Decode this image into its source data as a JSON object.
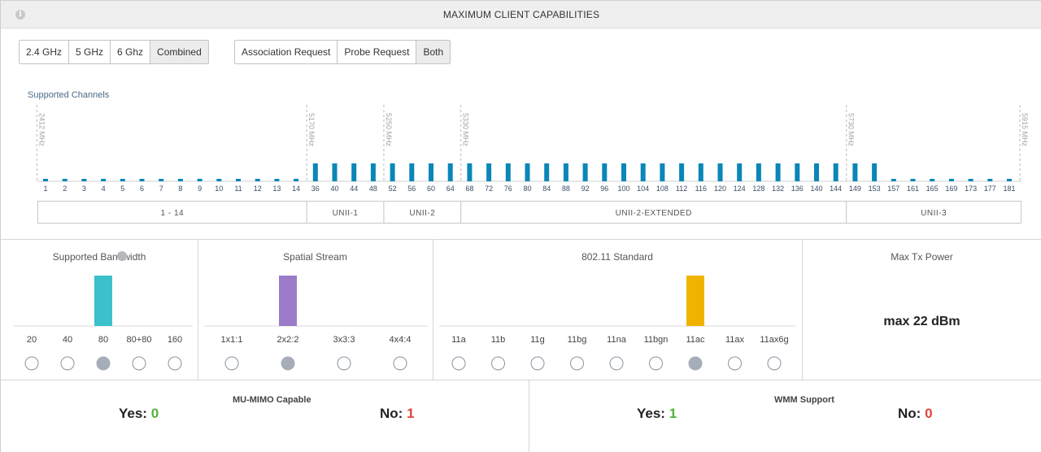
{
  "header": {
    "title": "MAXIMUM CLIENT CAPABILITIES"
  },
  "bands_filter": [
    "2.4 GHz",
    "5 GHz",
    "6 Ghz",
    "Combined"
  ],
  "bands_filter_active": "Combined",
  "request_filter": [
    "Association Request",
    "Probe Request",
    "Both"
  ],
  "request_filter_active": "Both",
  "channels": {
    "title": "Supported Channels",
    "bar_color": "#0a86b8",
    "labels": [
      "1",
      "2",
      "3",
      "4",
      "5",
      "6",
      "7",
      "8",
      "9",
      "10",
      "11",
      "12",
      "13",
      "14",
      "36",
      "40",
      "44",
      "48",
      "52",
      "56",
      "60",
      "64",
      "68",
      "72",
      "76",
      "80",
      "84",
      "88",
      "92",
      "96",
      "100",
      "104",
      "108",
      "112",
      "116",
      "120",
      "124",
      "128",
      "132",
      "136",
      "140",
      "144",
      "149",
      "153",
      "157",
      "161",
      "165",
      "169",
      "173",
      "177",
      "181"
    ],
    "supported": [
      0,
      0,
      0,
      0,
      0,
      0,
      0,
      0,
      0,
      0,
      0,
      0,
      0,
      0,
      1,
      1,
      1,
      1,
      1,
      1,
      1,
      1,
      1,
      1,
      1,
      1,
      1,
      1,
      1,
      1,
      1,
      1,
      1,
      1,
      1,
      1,
      1,
      1,
      1,
      1,
      1,
      1,
      1,
      1,
      0,
      0,
      0,
      0,
      0,
      0,
      0
    ],
    "freq_markers": [
      {
        "label": "2412 MHz",
        "before_index": 0
      },
      {
        "label": "5170 MHz",
        "before_index": 14
      },
      {
        "label": "5250 MHz",
        "before_index": 18
      },
      {
        "label": "5330 MHz",
        "before_index": 22
      },
      {
        "label": "5730 MHz",
        "before_index": 42
      },
      {
        "label": "5915 MHz",
        "before_index": 51
      }
    ],
    "bands": [
      {
        "label": "1 - 14",
        "from": 0,
        "to": 13
      },
      {
        "label": "UNII-1",
        "from": 14,
        "to": 17
      },
      {
        "label": "UNII-2",
        "from": 18,
        "to": 21
      },
      {
        "label": "UNII-2-EXTENDED",
        "from": 22,
        "to": 41
      },
      {
        "label": "UNII-3",
        "from": 42,
        "to": 50
      }
    ]
  },
  "bandwidth": {
    "title": "Supported Bandwidth",
    "color": "#3cc0cc",
    "labels": [
      "20",
      "40",
      "80",
      "80+80",
      "160"
    ],
    "selected": 2
  },
  "spatial": {
    "title": "Spatial Stream",
    "color": "#9b7cc8",
    "labels": [
      "1x1:1",
      "2x2:2",
      "3x3:3",
      "4x4:4"
    ],
    "selected": 1
  },
  "standard": {
    "title": "802.11 Standard",
    "color": "#f0b400",
    "labels": [
      "11a",
      "11b",
      "11g",
      "11bg",
      "11na",
      "11bgn",
      "11ac",
      "11ax",
      "11ax6g"
    ],
    "selected": 6
  },
  "tx_power": {
    "title": "Max Tx Power",
    "value": "max 22 dBm"
  },
  "mu_mimo": {
    "title": "MU-MIMO Capable",
    "yes_label": "Yes:",
    "yes_value": "0",
    "no_label": "No:",
    "no_value": "1"
  },
  "wmm": {
    "title": "WMM Support",
    "yes_label": "Yes:",
    "yes_value": "1",
    "no_label": "No:",
    "no_value": "0"
  }
}
